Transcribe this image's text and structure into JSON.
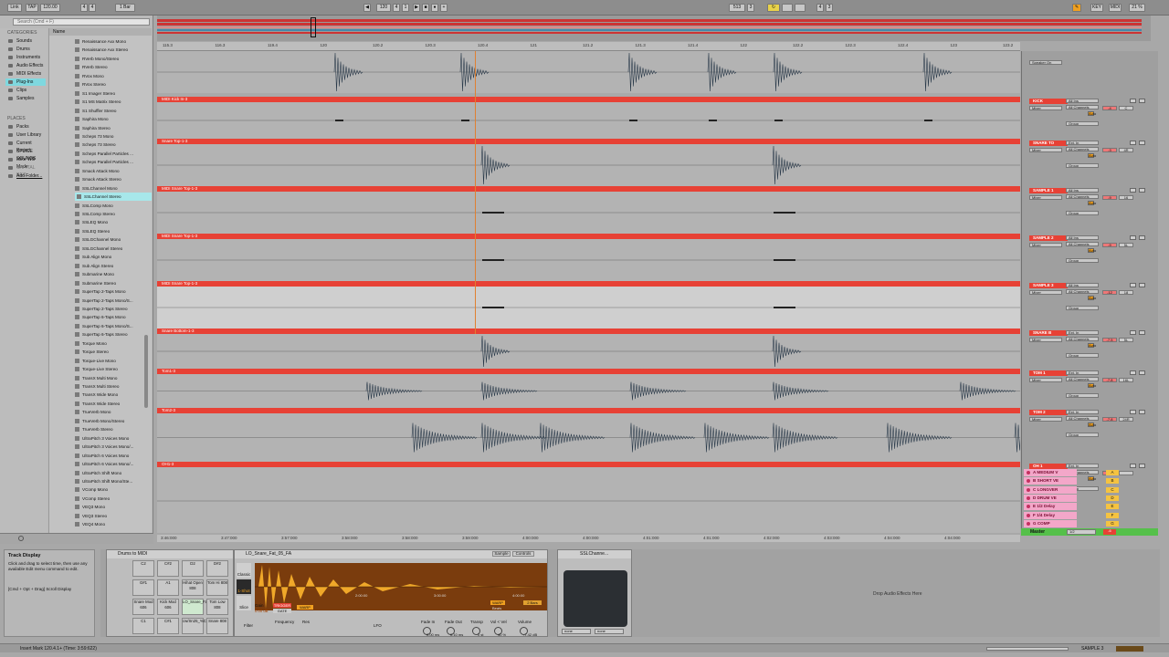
{
  "control_bar": {
    "link": "Link",
    "tap": "TAP",
    "tempo": "120.00",
    "sig_num": "4",
    "sig_den": "4",
    "quant": "1 Bar",
    "pos_bar": "120",
    "pos_beat": "4",
    "pos_sixteenth": "1",
    "loop_start": "513",
    "loop_start_beat": "3",
    "loop_len": "4",
    "loop_len_beat": "3",
    "key": "KEY",
    "midi": "MIDI",
    "cpu": "21 %"
  },
  "browser": {
    "search_placeholder": "Search (Cmd + F)",
    "categories_label": "CATEGORIES",
    "categories": [
      "Sounds",
      "Drums",
      "Instruments",
      "Audio Effects",
      "MIDI Effects",
      "Plug-Ins",
      "Clips",
      "Samples"
    ],
    "selected_category": "Plug-Ins",
    "places_label": "PLACES",
    "places": [
      "Packs",
      "User Library",
      "Current Project",
      "SPLICE SOUNDS",
      "Mike Will Made",
      "CAPITAL REC",
      "Add Folder..."
    ],
    "column_header": "Name",
    "files": [
      "Renaissance Axx Mono",
      "Renaissance Axx Stereo",
      "RVerb Mono/Stereo",
      "RVerb Stereo",
      "RVox Mono",
      "RVox Stereo",
      "S1 Imager Stereo",
      "S1 MS Matrix Stereo",
      "S1 Shuffler Stereo",
      "Saphira Mono",
      "Saphira Stereo",
      "Scheps 73 Mono",
      "Scheps 73 Stereo",
      "Scheps Parallel Particles ...",
      "Scheps Parallel Particles ...",
      "Smack Attack Mono",
      "Smack Attack Stereo",
      "SSLChannel Mono",
      "SSLChannel Stereo",
      "SSLComp Mono",
      "SSLComp Stereo",
      "SSLEQ Mono",
      "SSLEQ Stereo",
      "SSLGChannel Mono",
      "SSLGChannel Stereo",
      "Sub Align Mono",
      "Sub Align Stereo",
      "Submarine Mono",
      "Submarine Stereo",
      "SuperTap 2-Taps Mono",
      "SuperTap 2-Taps Mono/S...",
      "SuperTap 2-Taps Stereo",
      "SuperTap 6-Taps Mono",
      "SuperTap 6-Taps Mono/S...",
      "SuperTap 6-Taps Stereo",
      "Torque Mono",
      "Torque Stereo",
      "Torque-Live Mono",
      "Torque-Live Stereo",
      "TransX Multi Mono",
      "TransX Multi Stereo",
      "TransX Wide Mono",
      "TransX Wide Stereo",
      "TrueVerb Mono",
      "TrueVerb Mono/Stereo",
      "TrueVerb Stereo",
      "UltraPitch 3 Voices Mono",
      "UltraPitch 3 Voices Mono/...",
      "UltraPitch 6 Voices Mono",
      "UltraPitch 6 Voices Mono/...",
      "UltraPitch Shift Mono",
      "UltraPitch Shift Mono/Ste...",
      "VComp Mono",
      "VComp Stereo",
      "VEQ3 Mono",
      "VEQ3 Stereo",
      "VEQ4 Mono"
    ],
    "selected_file": "SSLChannel Stereo"
  },
  "ruler": {
    "bars": [
      "115.3",
      "116.3",
      "119.4",
      "120",
      "120.2",
      "120.3",
      "120.4",
      "121",
      "121.2",
      "121.3",
      "121.4",
      "122",
      "122.2",
      "122.3",
      "122.4",
      "123",
      "123.2"
    ],
    "times": [
      "3:46:000",
      "3:47:000",
      "3:57:000",
      "3:58:000",
      "3:58:000",
      "3:59:000",
      "4:00:000",
      "4:00:000",
      "4:01:000",
      "4:01:000",
      "4:02:000",
      "4:03:000",
      "4:04:000",
      "4:04:000"
    ]
  },
  "tracks": [
    {
      "clip": "",
      "name": "",
      "kind": "audio",
      "mix": "Speaker On",
      "vol": "",
      "pan": ""
    },
    {
      "clip": "MIDI Kick In-3",
      "name": "KICK",
      "kind": "midi",
      "mix": "Mixer",
      "vol": "-4",
      "pan": "C"
    },
    {
      "clip": "Snare Top-1-3",
      "name": "SNARE TO",
      "kind": "audio",
      "mix": "Mixer",
      "vol": "-3",
      "pan": "4R"
    },
    {
      "clip": "MIDI Snare Top-1-3",
      "name": "SAMPLE 1",
      "kind": "midi",
      "mix": "Mixer",
      "vol": "-9",
      "pan": "16"
    },
    {
      "clip": "MIDI Snare Top-1-3",
      "name": "SAMPLE 2",
      "kind": "midi",
      "mix": "Mixer",
      "vol": "-9",
      "pan": "5L"
    },
    {
      "clip": "MIDI Snare Top-1-3",
      "name": "SAMPLE 3",
      "kind": "midi",
      "mix": "Mixer",
      "vol": "-12",
      "pan": "18"
    },
    {
      "clip": "Snare Bottom-1-3",
      "name": "SNARE B",
      "kind": "audio",
      "mix": "Mixer",
      "vol": "-7.5",
      "pan": "5L"
    },
    {
      "clip": "Tom1-3",
      "name": "TOM 1",
      "kind": "audio",
      "mix": "Mixer",
      "vol": "-7.8",
      "pan": "16L"
    },
    {
      "clip": "Tom2-3",
      "name": "TOM 2",
      "kind": "audio",
      "mix": "Mixer",
      "vol": "-7.8",
      "pan": "24R"
    },
    {
      "clip": "OH1-3",
      "name": "OH 1",
      "kind": "audio",
      "mix": "Mixer",
      "vol": "",
      "pan": ""
    }
  ],
  "returns": [
    {
      "name": "A MEDIUM V",
      "letter": "A"
    },
    {
      "name": "B SHORT VE",
      "letter": "B"
    },
    {
      "name": "C LONGVER",
      "letter": "C"
    },
    {
      "name": "D DRUM VE",
      "letter": "D"
    },
    {
      "name": "E 1/2 Delay",
      "letter": "E"
    },
    {
      "name": "F 1/4 Delay",
      "letter": "F"
    },
    {
      "name": "G COMP",
      "letter": "G"
    }
  ],
  "master": {
    "name": "Master",
    "value": "1/2",
    "vol": "-6"
  },
  "io": {
    "ext_in": "Ext. In",
    "all_ins": "All Ins",
    "all_channels": "All Channels",
    "in": "In",
    "auto": "Auto",
    "off": "Off",
    "group": "Group",
    "inf": "-inf"
  },
  "info_view": {
    "title": "Track Display",
    "text": "Click and drag to select time, then use any available Edit menu command to edit.",
    "shortcut": "[Cmd + Opt + Drag] Scroll Display"
  },
  "drum_rack": {
    "title": "Drums to MIDI",
    "pads": [
      "C2",
      "C#2",
      "D2",
      "D#2",
      "G#1",
      "A1",
      "Hihat Open 808",
      "Tom Hi 808",
      "Snare Mod 606",
      "Kick Mod 606",
      "LO_Snare_Fat_05_FA",
      "Tom Low 808",
      "C1",
      "C#1",
      "cw/Sn25_%Chrome",
      "Snare 808"
    ]
  },
  "simpler": {
    "title": "LO_Snare_Fat_05_FA",
    "tab_sample": "Sample",
    "tab_controls": "Controls",
    "modes": [
      "Classic",
      "1-Shot",
      "Slice"
    ],
    "gain": "Gain",
    "gain_val": "0.00 dB",
    "trigger": "TRIGGER",
    "gate": "GATE",
    "warp": "WARP",
    "beats": "Beats",
    "bars_len": "2 Bars",
    "markers": [
      "2:00:00",
      "3:00:00",
      "4:00:00"
    ],
    "filter": "Filter",
    "frequency": "Frequency",
    "res": "Res",
    "lfo": "LFO",
    "fade_in": "Fade In",
    "fade_in_val": "0.00 ms",
    "fade_out": "Fade Out",
    "fade_out_val": "0.10 ms",
    "transp": "Transp",
    "transp_val": "0 st",
    "vol_vel": "Vol < Vel",
    "vol_vel_val": "40 %",
    "volume": "Volume",
    "volume_val": "-7.42 dB"
  },
  "plugin": {
    "title": "SSLChanne...",
    "sel1": "none",
    "sel2": "none"
  },
  "drop_hint": "Drop Audio Effects Here",
  "status": {
    "message": "Insert Mark 120.4.1+ (Time: 3:59:622)",
    "track": "SAMPLE 3"
  },
  "colors": {
    "track_red": "#e74135",
    "return_pink": "#f3a7c9",
    "master_green": "#55c04a",
    "accent_orange": "#f0a020",
    "selection_cyan": "#7fd8df"
  }
}
